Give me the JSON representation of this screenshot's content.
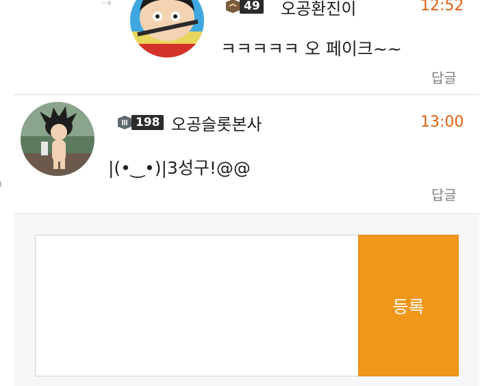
{
  "comments": [
    {
      "level": "49",
      "author": "오공환진이",
      "time": "12:52",
      "text": "ㅋㅋㅋㅋㅋ 오 페이크~~",
      "reply_label": "답글"
    },
    {
      "level": "198",
      "author": "오공슬롯본사",
      "time": "13:00",
      "text": "|(•‿•)|3성구!@@",
      "reply_label": "답글"
    }
  ],
  "composer": {
    "placeholder": "",
    "submit_label": "등록"
  },
  "colors": {
    "time": "#e0600f",
    "submit_button": "#f09619",
    "level_badge": "#2b2b2b"
  },
  "icons": [
    "reply-arrow-icon",
    "level-icon"
  ]
}
